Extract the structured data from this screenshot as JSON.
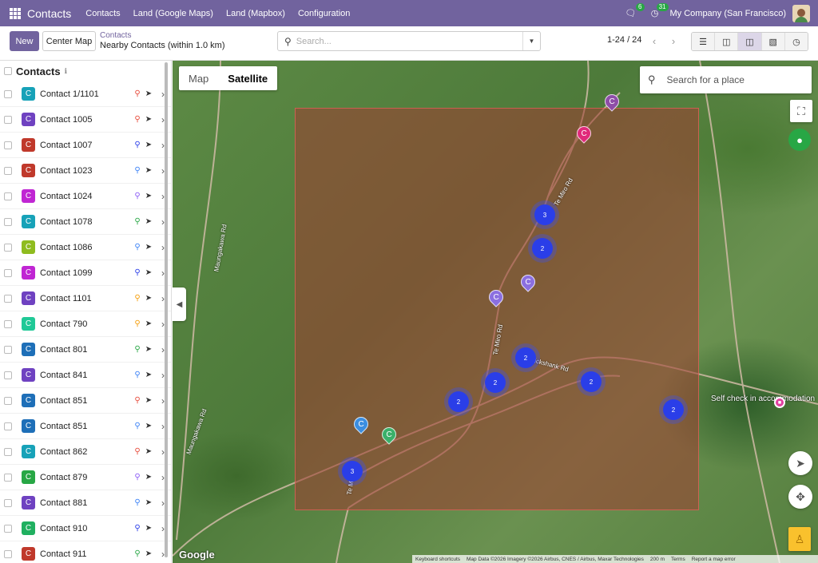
{
  "navbar": {
    "brand": "Contacts",
    "menu": [
      "Contacts",
      "Land (Google Maps)",
      "Land (Mapbox)",
      "Configuration"
    ],
    "messages_count": "6",
    "activities_count": "31",
    "company": "My Company (San Francisco)"
  },
  "control": {
    "new_label": "New",
    "center_map_label": "Center Map",
    "breadcrumb_parent": "Contacts",
    "breadcrumb_current": "Nearby Contacts (within 1.0 km)",
    "search_placeholder": "Search...",
    "pager": "1-24 / 24",
    "views": [
      "list",
      "kanban",
      "map",
      "google-map",
      "activity"
    ],
    "active_view": "map"
  },
  "sidebar": {
    "title": "Contacts",
    "rows": [
      {
        "label": "Contact 1/1101",
        "letter": "C",
        "color": "#17a2b8",
        "pin": "#e74c3c"
      },
      {
        "label": "Contact 1005",
        "letter": "C",
        "color": "#6f42c1",
        "pin": "#e74c3c"
      },
      {
        "label": "Contact 1007",
        "letter": "C",
        "color": "#c0392b",
        "pin": "#2a3ee8"
      },
      {
        "label": "Contact 1023",
        "letter": "C",
        "color": "#c0392b",
        "pin": "#3b82f6"
      },
      {
        "label": "Contact 1024",
        "letter": "C",
        "color": "#c026d3",
        "pin": "#8b5cf6"
      },
      {
        "label": "Contact 1078",
        "letter": "C",
        "color": "#17a2b8",
        "pin": "#28a745"
      },
      {
        "label": "Contact 1086",
        "letter": "C",
        "color": "#8fbc1f",
        "pin": "#3b82f6"
      },
      {
        "label": "Contact 1099",
        "letter": "C",
        "color": "#c026d3",
        "pin": "#2a3ee8"
      },
      {
        "label": "Contact 1101",
        "letter": "C",
        "color": "#6f42c1",
        "pin": "#f59e0b"
      },
      {
        "label": "Contact 790",
        "letter": "C",
        "color": "#20c997",
        "pin": "#f59e0b"
      },
      {
        "label": "Contact 801",
        "letter": "C",
        "color": "#1e6fb8",
        "pin": "#28a745"
      },
      {
        "label": "Contact 841",
        "letter": "C",
        "color": "#6f42c1",
        "pin": "#3b82f6"
      },
      {
        "label": "Contact 851",
        "letter": "C",
        "color": "#1e6fb8",
        "pin": "#e74c3c"
      },
      {
        "label": "Contact 851",
        "letter": "C",
        "color": "#1e6fb8",
        "pin": "#3b82f6"
      },
      {
        "label": "Contact 862",
        "letter": "C",
        "color": "#17a2b8",
        "pin": "#e74c3c"
      },
      {
        "label": "Contact 879",
        "letter": "C",
        "color": "#28a745",
        "pin": "#8b5cf6"
      },
      {
        "label": "Contact 881",
        "letter": "C",
        "color": "#6f42c1",
        "pin": "#3b82f6"
      },
      {
        "label": "Contact 910",
        "letter": "C",
        "color": "#20b060",
        "pin": "#2a3ee8"
      },
      {
        "label": "Contact 911",
        "letter": "C",
        "color": "#c0392b",
        "pin": "#28a745"
      }
    ]
  },
  "map": {
    "type_map_label": "Map",
    "type_satellite_label": "Satellite",
    "active_type": "Satellite",
    "place_search_placeholder": "Search for a place",
    "road_labels": [
      "Te Miro Rd",
      "Te Miro Rd",
      "Cruickshank Rd",
      "Te Miro Rd",
      "Maungakawa Rd",
      "Maungakawa Rd"
    ],
    "place_label": "Self check in accommodation",
    "clusters": [
      "3",
      "2",
      "2",
      "2",
      "2",
      "2",
      "2",
      "3"
    ],
    "pins": [
      {
        "letter": "C",
        "color": "#8e4ea8"
      },
      {
        "letter": "C",
        "color": "#e02a7a"
      },
      {
        "letter": "C",
        "color": "#8b6fe0"
      },
      {
        "letter": "C",
        "color": "#8b6fe0"
      },
      {
        "letter": "C",
        "color": "#3b8ee0"
      },
      {
        "letter": "C",
        "color": "#3bb06a"
      }
    ],
    "google_logo": "Google",
    "attribution": [
      "Keyboard shortcuts",
      "Map Data ©2026 Imagery ©2026 Airbus, CNES / Airbus, Maxar Technologies",
      "200 m",
      "Terms",
      "Report a map error"
    ]
  }
}
